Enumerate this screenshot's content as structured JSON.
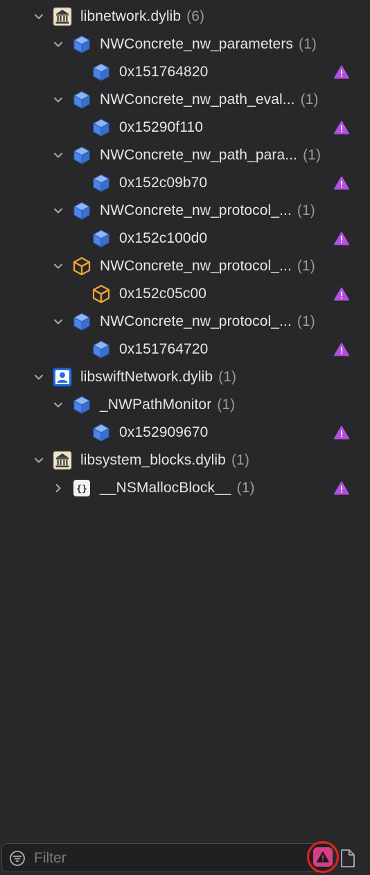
{
  "tree": {
    "rows": [
      {
        "label": "libnetwork.dylib",
        "count": "(6)",
        "icon": "library-icon",
        "level": 0,
        "disclosure": "expanded",
        "warning": false
      },
      {
        "label": "NWConcrete_nw_parameters",
        "count": "(1)",
        "icon": "class-cube-icon",
        "level": 1,
        "disclosure": "expanded",
        "warning": false
      },
      {
        "label": "0x151764820",
        "count": "",
        "icon": "instance-cube-icon",
        "level": 2,
        "disclosure": "none",
        "warning": true
      },
      {
        "label": "NWConcrete_nw_path_eval...",
        "count": "(1)",
        "icon": "class-cube-icon",
        "level": 1,
        "disclosure": "expanded",
        "warning": false
      },
      {
        "label": "0x15290f110",
        "count": "",
        "icon": "instance-cube-icon",
        "level": 2,
        "disclosure": "none",
        "warning": true
      },
      {
        "label": "NWConcrete_nw_path_para...",
        "count": "(1)",
        "icon": "class-cube-icon",
        "level": 1,
        "disclosure": "expanded",
        "warning": false
      },
      {
        "label": "0x152c09b70",
        "count": "",
        "icon": "instance-cube-icon",
        "level": 2,
        "disclosure": "none",
        "warning": true
      },
      {
        "label": "NWConcrete_nw_protocol_...",
        "count": "(1)",
        "icon": "class-cube-icon",
        "level": 1,
        "disclosure": "expanded",
        "warning": false
      },
      {
        "label": "0x152c100d0",
        "count": "",
        "icon": "instance-cube-icon",
        "level": 2,
        "disclosure": "none",
        "warning": true
      },
      {
        "label": "NWConcrete_nw_protocol_...",
        "count": "(1)",
        "icon": "swift-class-cube-icon",
        "level": 1,
        "disclosure": "expanded",
        "warning": false
      },
      {
        "label": "0x152c05c00",
        "count": "",
        "icon": "swift-instance-cube-icon",
        "level": 2,
        "disclosure": "none",
        "warning": true
      },
      {
        "label": "NWConcrete_nw_protocol_...",
        "count": "(1)",
        "icon": "class-cube-icon",
        "level": 1,
        "disclosure": "expanded",
        "warning": false
      },
      {
        "label": "0x151764720",
        "count": "",
        "icon": "instance-cube-icon",
        "level": 2,
        "disclosure": "none",
        "warning": true
      },
      {
        "label": "libswiftNetwork.dylib",
        "count": "(1)",
        "icon": "user-library-icon",
        "level": 0,
        "disclosure": "expanded",
        "warning": false
      },
      {
        "label": "_NWPathMonitor",
        "count": "(1)",
        "icon": "class-cube-icon",
        "level": 1,
        "disclosure": "expanded",
        "warning": false
      },
      {
        "label": "0x152909670",
        "count": "",
        "icon": "instance-cube-icon",
        "level": 2,
        "disclosure": "none",
        "warning": true
      },
      {
        "label": "libsystem_blocks.dylib",
        "count": "(1)",
        "icon": "library-icon",
        "level": 0,
        "disclosure": "expanded",
        "warning": false
      },
      {
        "label": "__NSMallocBlock__",
        "count": "(1)",
        "icon": "block-braces-icon",
        "level": 1,
        "disclosure": "collapsed",
        "warning": true
      }
    ]
  },
  "filter": {
    "placeholder": "Filter",
    "value": "",
    "filter_icon": "filter-icon",
    "issue_toggle_icon": "warning-icon",
    "doc_toggle_icon": "document-icon"
  },
  "colors": {
    "background": "#28282a",
    "class_blue": "#4a86e8",
    "swift_orange": "#f0a732",
    "warning_purple": "#b44fe0",
    "highlight_ring": "#e2231a",
    "issue_toggle_fill": "#d93d86"
  }
}
